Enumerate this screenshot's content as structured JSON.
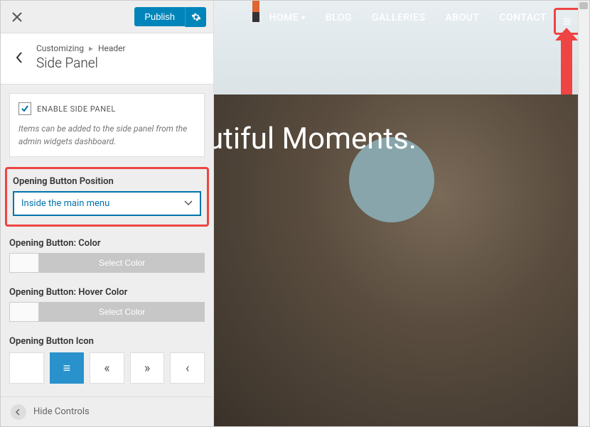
{
  "header": {
    "publish_label": "Publish"
  },
  "breadcrumb": {
    "root": "Customizing",
    "section": "Header",
    "title": "Side Panel"
  },
  "enable": {
    "label": "ENABLE SIDE PANEL",
    "desc": "Items can be added to the side panel from the admin widgets dashboard."
  },
  "fields": {
    "position_label": "Opening Button Position",
    "position_value": "Inside the main menu",
    "color_label": "Opening Button: Color",
    "hover_label": "Opening Button: Hover Color",
    "select_color": "Select Color",
    "icon_label": "Opening Button Icon"
  },
  "footer": {
    "hide": "Hide Controls"
  },
  "nav": {
    "items": [
      "HOME",
      "BLOG",
      "GALLERIES",
      "ABOUT",
      "CONTACT"
    ]
  },
  "hero": {
    "text": "utiful Moments."
  },
  "icons": {
    "bars": "≡",
    "dleft": "«",
    "dright": "»",
    "left": "‹"
  }
}
